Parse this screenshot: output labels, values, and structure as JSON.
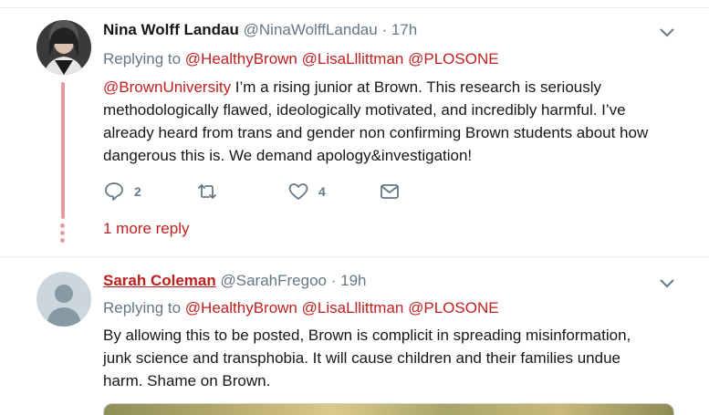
{
  "tweets": [
    {
      "name": "Nina Wolff Landau",
      "handle": "@NinaWolffLandau",
      "separator": "·",
      "time": "17h",
      "replying_prefix": "Replying to",
      "replying_to": [
        "@HealthyBrown",
        "@LisaLllittman",
        "@PLOSONE"
      ],
      "text_mention": "@BrownUniversity",
      "text_lines": [
        " I’m a rising junior at Brown. This research is seriously",
        "methodologically flawed, ideologically motivated, and incredibly harmful. I’ve",
        "already heard from trans and gender non confirming Brown students about how",
        "dangerous this is. We demand apology&investigation!"
      ],
      "reply_count": "2",
      "retweet_count": "",
      "like_count": "4",
      "more_replies": "1 more reply"
    },
    {
      "name": "Sarah Coleman",
      "handle": "@SarahFregoo",
      "separator": "·",
      "time": "19h",
      "replying_prefix": "Replying to",
      "replying_to": [
        "@HealthyBrown",
        "@LisaLllittman",
        "@PLOSONE"
      ],
      "text_lines": [
        "By allowing this to be posted, Brown is complicit in spreading misinformation,",
        "junk science and transphobia. It will cause children and their families undue",
        "harm. Shame on Brown."
      ]
    }
  ],
  "colors": {
    "accent": "#c01f1f",
    "muted": "#657786",
    "thread_line": "#e89aa0"
  },
  "icons": {
    "reply": "reply-icon",
    "retweet": "retweet-icon",
    "like": "heart-icon",
    "dm": "envelope-icon",
    "caret": "chevron-down-icon"
  }
}
